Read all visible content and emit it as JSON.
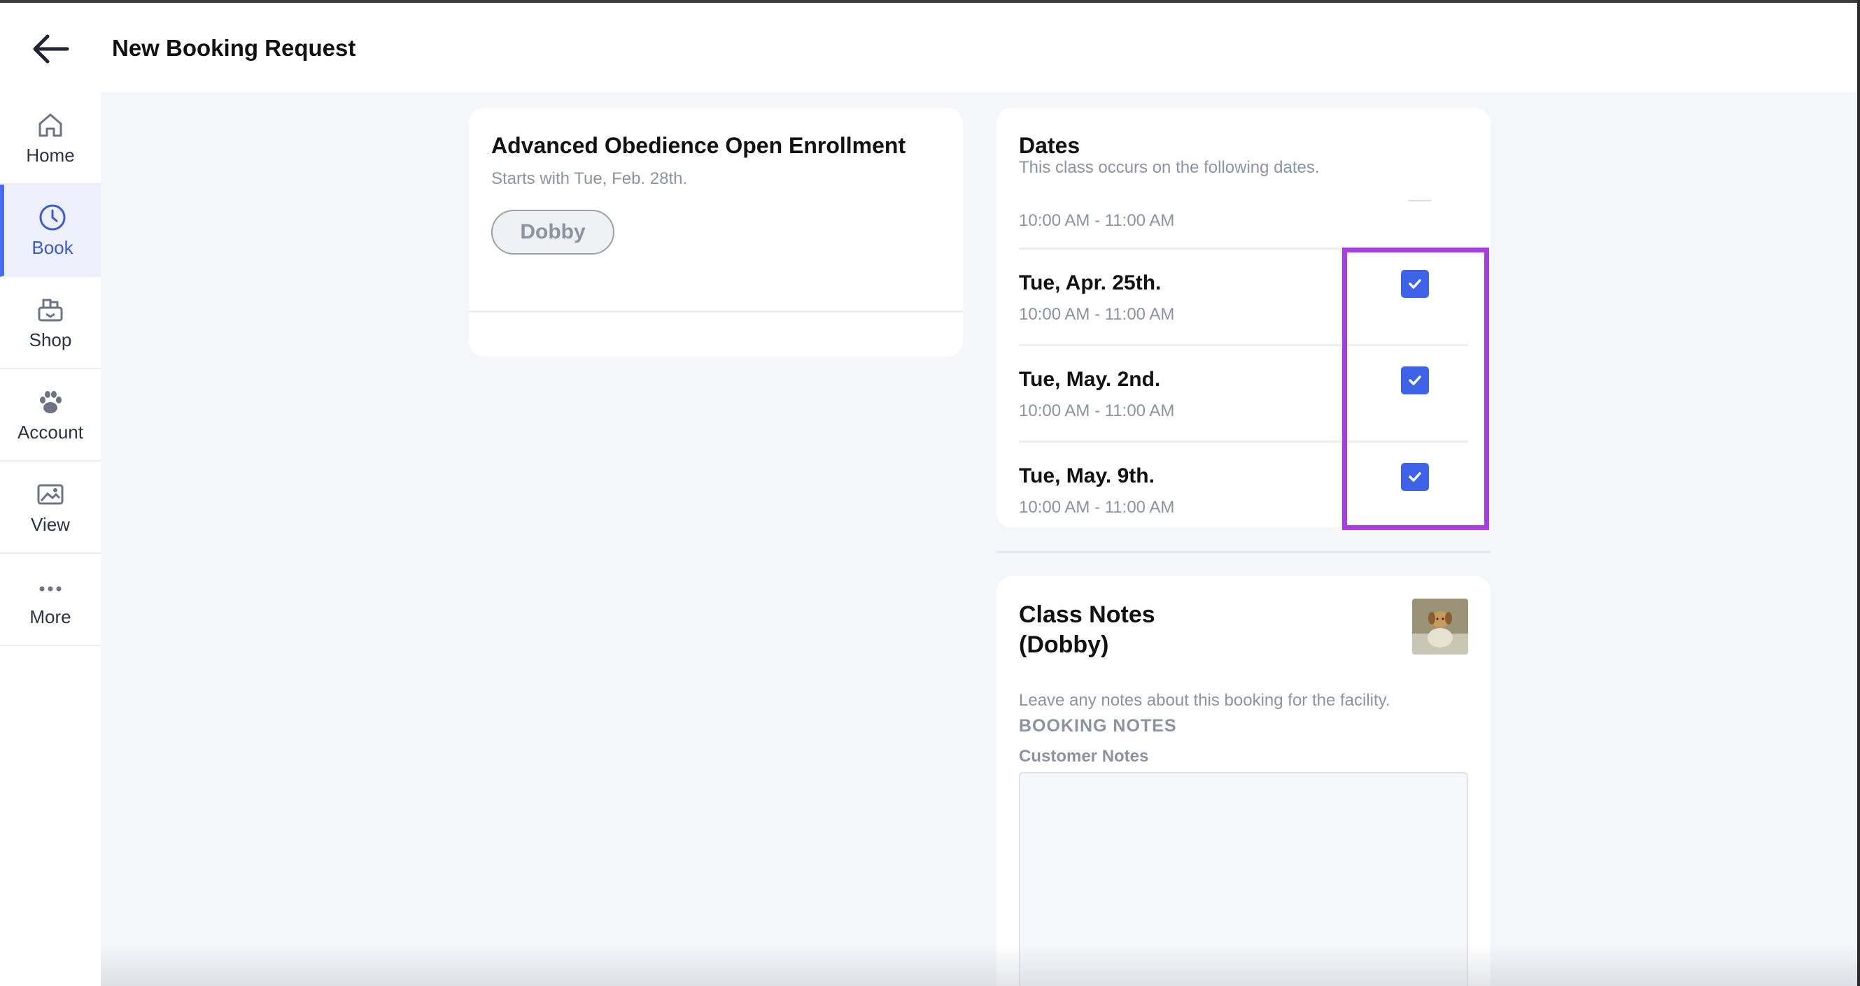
{
  "header": {
    "title": "New Booking Request"
  },
  "sidebar": {
    "items": [
      {
        "label": "Home",
        "icon": "home-icon",
        "active": false
      },
      {
        "label": "Book",
        "icon": "clock-icon",
        "active": true
      },
      {
        "label": "Shop",
        "icon": "shop-icon",
        "active": false
      },
      {
        "label": "Account",
        "icon": "paw-icon",
        "active": false
      },
      {
        "label": "View",
        "icon": "image-icon",
        "active": false
      },
      {
        "label": "More",
        "icon": "more-dots-icon",
        "active": false
      }
    ]
  },
  "class_card": {
    "title": "Advanced Obedience Open Enrollment",
    "subtitle": "Starts with Tue, Feb. 28th.",
    "pet": "Dobby"
  },
  "dates": {
    "title": "Dates",
    "subtitle": "This class occurs on the following dates.",
    "top_time": "10:00 AM - 11:00 AM",
    "rows": [
      {
        "date": "Tue, Apr. 25th.",
        "time": "10:00 AM - 11:00 AM",
        "checked": true
      },
      {
        "date": "Tue, May. 2nd.",
        "time": "10:00 AM - 11:00 AM",
        "checked": true
      },
      {
        "date": "Tue, May. 9th.",
        "time": "10:00 AM - 11:00 AM",
        "checked": true
      }
    ]
  },
  "notes": {
    "title_line1": "Class Notes",
    "title_line2": "(Dobby)",
    "subtitle": "Leave any notes about this booking for the facility.",
    "section": "BOOKING NOTES",
    "field_label": "Customer Notes",
    "field_value": ""
  },
  "colors": {
    "accent": "#3f63e8",
    "highlight": "#a93de0",
    "muted_text": "#8c93a0"
  }
}
